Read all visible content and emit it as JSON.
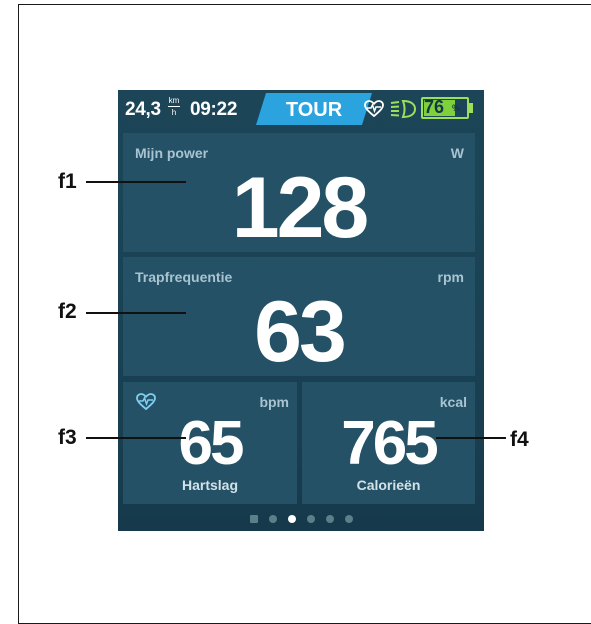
{
  "status": {
    "speed": "24,3",
    "speed_unit_top": "km",
    "speed_unit_bottom": "h",
    "time": "09:22",
    "mode": "TOUR",
    "battery_level": "76",
    "battery_percent_sign": "%",
    "battery_fraction": 0.76,
    "heart_icon": "heart-rate-icon",
    "light_icon": "headlight-icon"
  },
  "tiles": {
    "power": {
      "label": "Mijn power",
      "unit": "W",
      "value": "128"
    },
    "cadence": {
      "label": "Trapfrequentie",
      "unit": "rpm",
      "value": "63"
    },
    "heart": {
      "label": "Hartslag",
      "unit": "bpm",
      "value": "65",
      "icon": "heart-rate-icon"
    },
    "calories": {
      "label": "Calorieën",
      "unit": "kcal",
      "value": "765"
    }
  },
  "callouts": {
    "f1": "f1",
    "f2": "f2",
    "f3": "f3",
    "f4": "f4"
  },
  "pager": {
    "count": 6,
    "active_index": 2
  },
  "colors": {
    "mode_accent": "#2aa3df",
    "battery": "#7fd13b",
    "heart_icon": "#7fd0f0"
  }
}
